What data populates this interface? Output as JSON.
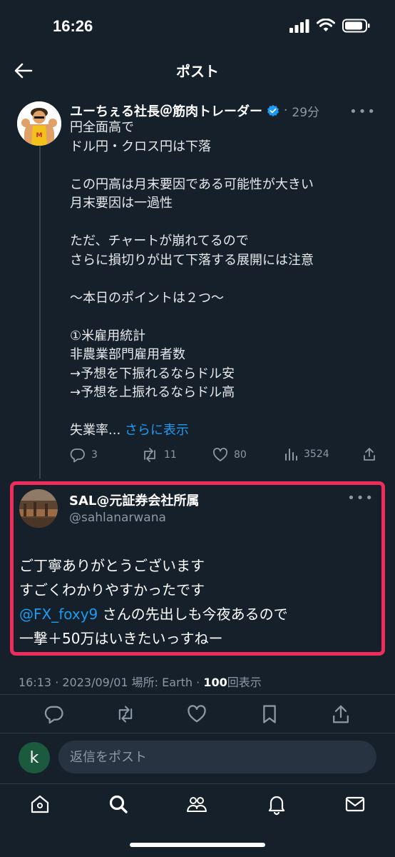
{
  "status_bar": {
    "time": "16:26"
  },
  "header": {
    "title": "ポスト"
  },
  "post": {
    "author": "ユーちぇる社長＠筋肉トレーダー",
    "separator": "·",
    "time_ago": "29分",
    "lines": [
      "円全面高で",
      "ドル円・クロス円は下落",
      "",
      "この円高は月末要因である可能性が大きい",
      "月末要因は一過性",
      "",
      "ただ、チャートが崩れてるので",
      "さらに損切りが出て下落する展開には注意",
      "",
      "〜本日のポイントは２つ〜",
      "",
      "①米雇用統計",
      "非農業部門雇用者数",
      "→予想を下振れるならドル安",
      "→予想を上振れるならドル高",
      ""
    ],
    "truncated_text": "失業率...",
    "show_more": "さらに表示",
    "replies": "3",
    "reposts": "11",
    "likes": "80",
    "views": "3524"
  },
  "reply": {
    "name": "SAL@元証券会社所属",
    "handle": "@sahlanarwana",
    "line1": "ご丁寧ありがとうございます",
    "line2": "すごくわかりやすかったです",
    "mention": "@FX_foxy9",
    "line3_rest": " さんの先出しも今夜あるので",
    "line4": "一撃＋50万はいきたいっすねー"
  },
  "meta": {
    "prefix": "16:13 · 2023/09/01 場所: Earth · ",
    "views_count": "100",
    "views_label": "回表示"
  },
  "composer": {
    "avatar_letter": "k",
    "placeholder": "返信をポスト"
  },
  "colors": {
    "accent": "#1d9bf0",
    "highlight_border": "#f02c5c",
    "background": "#15202b"
  }
}
